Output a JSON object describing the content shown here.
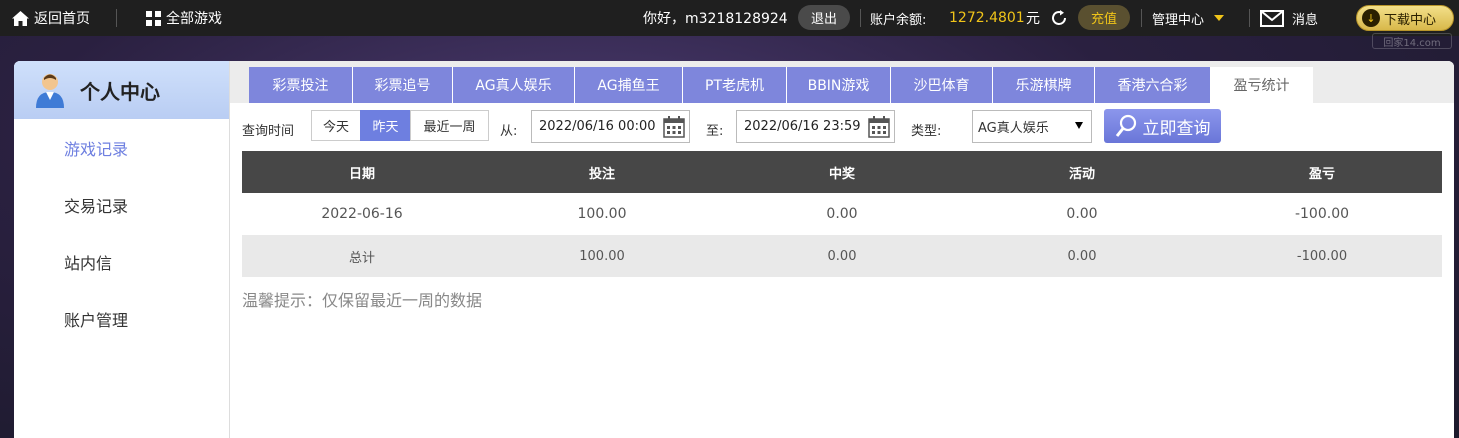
{
  "topbar": {
    "home_label": "返回首页",
    "all_games_label": "全部游戏",
    "greeting": "你好，m3218128924",
    "logout_label": "退出",
    "balance_label": "账户余额:",
    "balance_value": "1272.4801",
    "balance_unit": "元",
    "recharge_label": "充值",
    "manage_label": "管理中心",
    "message_label": "消息",
    "download_label": "下载中心",
    "watermark": "回家14.com"
  },
  "sidebar": {
    "title": "个人中心",
    "items": [
      {
        "label": "游戏记录"
      },
      {
        "label": "交易记录"
      },
      {
        "label": "站内信"
      },
      {
        "label": "账户管理"
      }
    ]
  },
  "tabs": [
    {
      "label": "彩票投注"
    },
    {
      "label": "彩票追号"
    },
    {
      "label": "AG真人娱乐"
    },
    {
      "label": "AG捕鱼王"
    },
    {
      "label": "PT老虎机"
    },
    {
      "label": "BBIN游戏"
    },
    {
      "label": "沙巴体育"
    },
    {
      "label": "乐游棋牌"
    },
    {
      "label": "香港六合彩"
    },
    {
      "label": "盈亏统计"
    }
  ],
  "filters": {
    "query_time_label": "查询时间",
    "today_label": "今天",
    "yesterday_label": "昨天",
    "week_label": "最近一周",
    "from_label": "从:",
    "from_value": "2022/06/16 00:00",
    "to_label": "至:",
    "to_value": "2022/06/16 23:59",
    "type_label": "类型:",
    "type_value": "AG真人娱乐",
    "query_button": "立即查询"
  },
  "table": {
    "headers": [
      "日期",
      "投注",
      "中奖",
      "活动",
      "盈亏"
    ],
    "rows": [
      [
        "2022-06-16",
        "100.00",
        "0.00",
        "0.00",
        "-100.00"
      ],
      [
        "总计",
        "100.00",
        "0.00",
        "0.00",
        "-100.00"
      ]
    ]
  },
  "hint": "温馨提示：仅保留最近一周的数据",
  "colors": {
    "accent": "#7e86dc",
    "active_text": "#6e7fe0",
    "balance": "#f0c419",
    "topbar_bg": "#1f1f1f",
    "table_header_bg": "#474747"
  }
}
